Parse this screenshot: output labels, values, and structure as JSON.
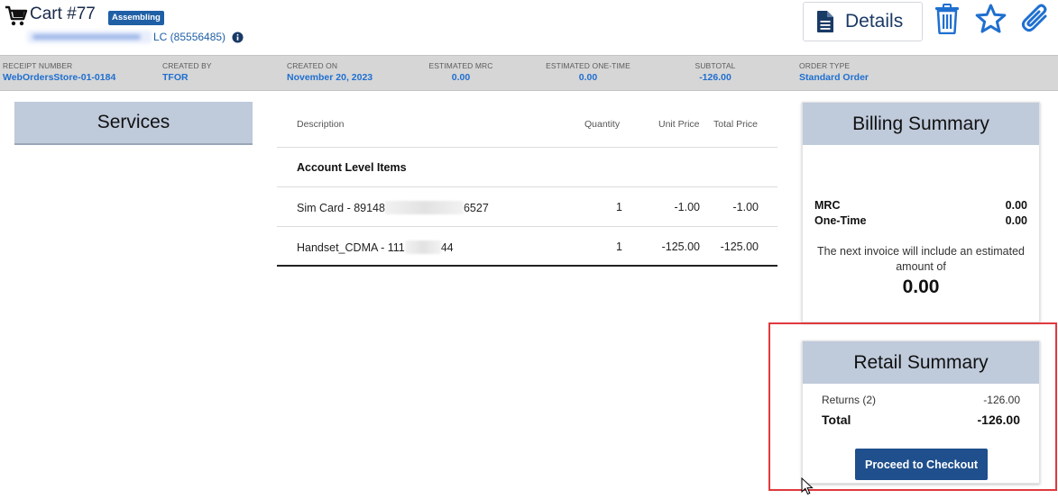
{
  "header": {
    "cart_title": "Cart #77",
    "status": "Assembling",
    "account_suffix": "LC (85556485)",
    "details_label": "Details"
  },
  "icons": {
    "cart": "cart-icon",
    "info": "info-icon",
    "details": "document-icon",
    "delete": "trash-icon",
    "favorite": "star-icon",
    "attach": "paperclip-icon"
  },
  "info_bar": [
    {
      "label": "RECEIPT NUMBER",
      "value": "WebOrdersStore-01-0184"
    },
    {
      "label": "CREATED BY",
      "value": "TFOR"
    },
    {
      "label": "CREATED ON",
      "value": "November 20, 2023"
    },
    {
      "label": "ESTIMATED MRC",
      "value": "0.00"
    },
    {
      "label": "ESTIMATED ONE-TIME",
      "value": "0.00"
    },
    {
      "label": "SUBTOTAL",
      "value": "-126.00"
    },
    {
      "label": "ORDER TYPE",
      "value": "Standard Order"
    }
  ],
  "services": {
    "title": "Services"
  },
  "items": {
    "columns": [
      "Description",
      "Quantity",
      "Unit Price",
      "Total Price"
    ],
    "group": "Account Level Items",
    "rows": [
      {
        "desc_prefix": "Sim Card - 89148",
        "desc_suffix": "6527",
        "qty": "1",
        "unit": "-1.00",
        "total": "-1.00"
      },
      {
        "desc_prefix": "Handset_CDMA - 111",
        "desc_suffix": "44",
        "qty": "1",
        "unit": "-125.00",
        "total": "-125.00"
      }
    ]
  },
  "billing": {
    "title": "Billing Summary",
    "mrc_label": "MRC",
    "mrc_value": "0.00",
    "onetime_label": "One-Time",
    "onetime_value": "0.00",
    "note": "The next invoice will include an estimated amount of",
    "amount": "0.00"
  },
  "retail": {
    "title": "Retail Summary",
    "returns_label": "Returns (2)",
    "returns_value": "-126.00",
    "total_label": "Total",
    "total_value": "-126.00",
    "checkout_label": "Proceed to Checkout"
  },
  "colors": {
    "accent": "#1f5fa6",
    "link": "#1f6fd0",
    "panel_header": "#bfcadb",
    "info_bar": "#d6d6d6",
    "highlight": "#e0393e",
    "button": "#1f4f8c"
  }
}
